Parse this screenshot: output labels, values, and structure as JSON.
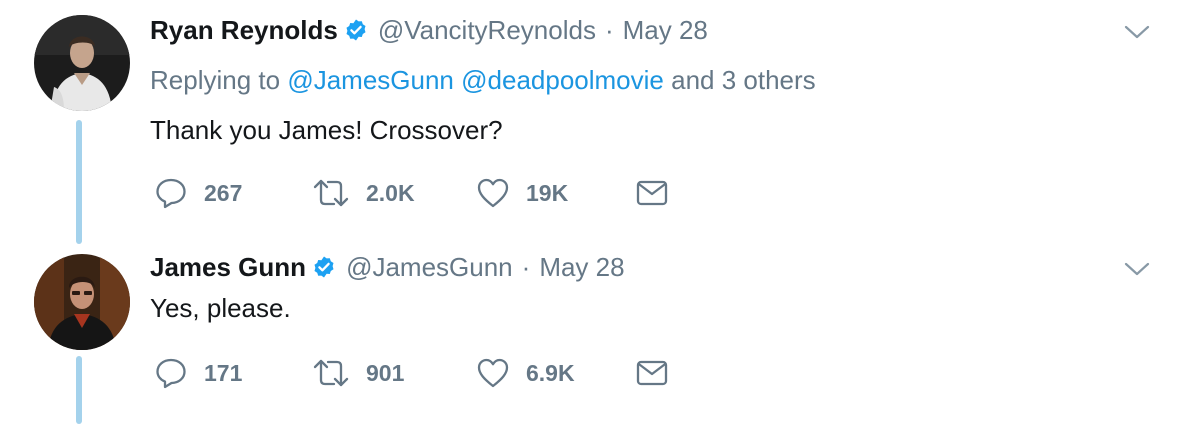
{
  "colors": {
    "link": "#1b95e0",
    "muted": "#657786",
    "text": "#14171a",
    "thread_line": "#a4d2ec",
    "verified": "#1da1f2"
  },
  "tweets": [
    {
      "author_name": "Ryan Reynolds",
      "verified": true,
      "handle": "@VancityReynolds",
      "separator": "·",
      "date": "May 28",
      "replying": {
        "prefix": "Replying to",
        "mentions": [
          "@JamesGunn",
          "@deadpoolmovie"
        ],
        "suffix": "and 3 others"
      },
      "text": "Thank you James! Crossover?",
      "reply_count": "267",
      "retweet_count": "2.0K",
      "like_count": "19K",
      "icons": [
        "reply-icon",
        "retweet-icon",
        "like-icon",
        "direct-message-icon",
        "chevron-down-icon"
      ]
    },
    {
      "author_name": "James Gunn",
      "verified": true,
      "handle": "@JamesGunn",
      "separator": "·",
      "date": "May 28",
      "text": "Yes, please.",
      "reply_count": "171",
      "retweet_count": "901",
      "like_count": "6.9K",
      "icons": [
        "reply-icon",
        "retweet-icon",
        "like-icon",
        "direct-message-icon",
        "chevron-down-icon"
      ]
    }
  ]
}
